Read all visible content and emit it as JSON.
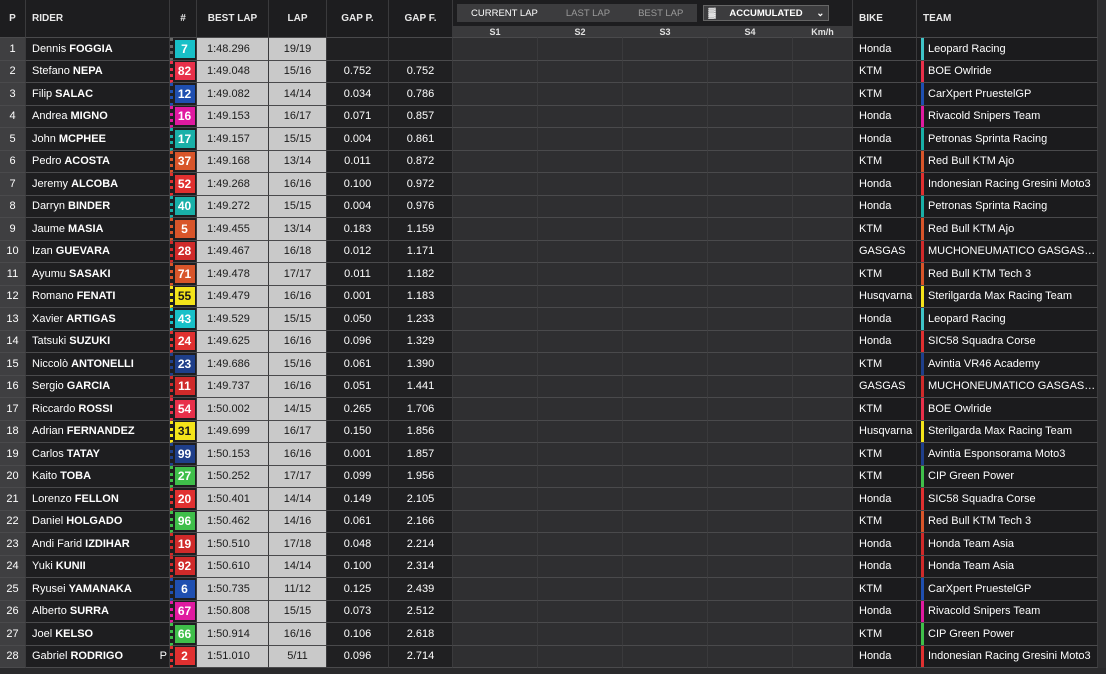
{
  "headers": {
    "pos": "P",
    "rider": "RIDER",
    "num": "#",
    "best_lap": "BEST LAP",
    "lap": "LAP",
    "gap_p": "GAP P.",
    "gap_f": "GAP F.",
    "bike": "BIKE",
    "team": "TEAM",
    "tabs": [
      "CURRENT LAP",
      "LAST LAP",
      "BEST LAP"
    ],
    "mode": "ACCUMULATED",
    "sectors": [
      "S1",
      "S2",
      "S3",
      "S4",
      "Km/h"
    ]
  },
  "rows": [
    {
      "pos": "1",
      "first": "Dennis",
      "last": "FOGGIA",
      "num": "7",
      "num_bg": "#18c0c8",
      "num_fg": "#ffffff",
      "flag": "#6a6a6a",
      "best": "1:48.296",
      "lap": "19/19",
      "gap_p": "",
      "gap_f": "",
      "bike": "Honda",
      "team": "Leopard Racing",
      "team_color": "#3fc4c8",
      "pit": ""
    },
    {
      "pos": "2",
      "first": "Stefano",
      "last": "NEPA",
      "num": "82",
      "num_bg": "#e8304a",
      "num_fg": "#ffffff",
      "flag": "#e8304a",
      "best": "1:49.048",
      "lap": "15/16",
      "gap_p": "0.752",
      "gap_f": "0.752",
      "bike": "KTM",
      "team": "BOE Owlride",
      "team_color": "#e8304a",
      "pit": ""
    },
    {
      "pos": "3",
      "first": "Filip",
      "last": "SALAC",
      "num": "12",
      "num_bg": "#1f4fb0",
      "num_fg": "#ffffff",
      "flag": "#1f4fb0",
      "best": "1:49.082",
      "lap": "14/14",
      "gap_p": "0.034",
      "gap_f": "0.786",
      "bike": "KTM",
      "team": "CarXpert PruestelGP",
      "team_color": "#1f4fb0",
      "pit": ""
    },
    {
      "pos": "4",
      "first": "Andrea",
      "last": "MIGNO",
      "num": "16",
      "num_bg": "#e01aa0",
      "num_fg": "#ffffff",
      "flag": "#e01aa0",
      "best": "1:49.153",
      "lap": "16/17",
      "gap_p": "0.071",
      "gap_f": "0.857",
      "bike": "Honda",
      "team": "Rivacold Snipers Team",
      "team_color": "#e01aa0",
      "pit": ""
    },
    {
      "pos": "5",
      "first": "John",
      "last": "MCPHEE",
      "num": "17",
      "num_bg": "#19b0a8",
      "num_fg": "#ffffff",
      "flag": "#19b0a8",
      "best": "1:49.157",
      "lap": "15/15",
      "gap_p": "0.004",
      "gap_f": "0.861",
      "bike": "Honda",
      "team": "Petronas Sprinta Racing",
      "team_color": "#19b0a8",
      "pit": ""
    },
    {
      "pos": "6",
      "first": "Pedro",
      "last": "ACOSTA",
      "num": "37",
      "num_bg": "#d8552a",
      "num_fg": "#ffffff",
      "flag": "#d8552a",
      "best": "1:49.168",
      "lap": "13/14",
      "gap_p": "0.011",
      "gap_f": "0.872",
      "bike": "KTM",
      "team": "Red Bull KTM Ajo",
      "team_color": "#d8552a",
      "pit": ""
    },
    {
      "pos": "7",
      "first": "Jeremy",
      "last": "ALCOBA",
      "num": "52",
      "num_bg": "#e03030",
      "num_fg": "#ffffff",
      "flag": "#e03030",
      "best": "1:49.268",
      "lap": "16/16",
      "gap_p": "0.100",
      "gap_f": "0.972",
      "bike": "Honda",
      "team": "Indonesian Racing Gresini Moto3",
      "team_color": "#e03030",
      "pit": ""
    },
    {
      "pos": "8",
      "first": "Darryn",
      "last": "BINDER",
      "num": "40",
      "num_bg": "#19b0a8",
      "num_fg": "#ffffff",
      "flag": "#19b0a8",
      "best": "1:49.272",
      "lap": "15/15",
      "gap_p": "0.004",
      "gap_f": "0.976",
      "bike": "Honda",
      "team": "Petronas Sprinta Racing",
      "team_color": "#19b0a8",
      "pit": ""
    },
    {
      "pos": "9",
      "first": "Jaume",
      "last": "MASIA",
      "num": "5",
      "num_bg": "#d8552a",
      "num_fg": "#ffffff",
      "flag": "#d8552a",
      "best": "1:49.455",
      "lap": "13/14",
      "gap_p": "0.183",
      "gap_f": "1.159",
      "bike": "KTM",
      "team": "Red Bull KTM Ajo",
      "team_color": "#d8552a",
      "pit": ""
    },
    {
      "pos": "10",
      "first": "Izan",
      "last": "GUEVARA",
      "num": "28",
      "num_bg": "#d02a2a",
      "num_fg": "#ffffff",
      "flag": "#d02a2a",
      "best": "1:49.467",
      "lap": "16/18",
      "gap_p": "0.012",
      "gap_f": "1.171",
      "bike": "GASGAS",
      "team": "MUCHONEUMATICO GASGAS Asp...",
      "team_color": "#d02a2a",
      "pit": ""
    },
    {
      "pos": "11",
      "first": "Ayumu",
      "last": "SASAKI",
      "num": "71",
      "num_bg": "#d8552a",
      "num_fg": "#ffffff",
      "flag": "#d8552a",
      "best": "1:49.478",
      "lap": "17/17",
      "gap_p": "0.011",
      "gap_f": "1.182",
      "bike": "KTM",
      "team": "Red Bull KTM Tech 3",
      "team_color": "#d8552a",
      "pit": ""
    },
    {
      "pos": "12",
      "first": "Romano",
      "last": "FENATI",
      "num": "55",
      "num_bg": "#f4e41a",
      "num_fg": "#1a1a1a",
      "flag": "#f4e41a",
      "best": "1:49.479",
      "lap": "16/16",
      "gap_p": "0.001",
      "gap_f": "1.183",
      "bike": "Husqvarna",
      "team": "Sterilgarda Max Racing Team",
      "team_color": "#f4e41a",
      "pit": ""
    },
    {
      "pos": "13",
      "first": "Xavier",
      "last": "ARTIGAS",
      "num": "43",
      "num_bg": "#18c0c8",
      "num_fg": "#ffffff",
      "flag": "#18c0c8",
      "best": "1:49.529",
      "lap": "15/15",
      "gap_p": "0.050",
      "gap_f": "1.233",
      "bike": "Honda",
      "team": "Leopard Racing",
      "team_color": "#3fc4c8",
      "pit": ""
    },
    {
      "pos": "14",
      "first": "Tatsuki",
      "last": "SUZUKI",
      "num": "24",
      "num_bg": "#e03030",
      "num_fg": "#ffffff",
      "flag": "#e03030",
      "best": "1:49.625",
      "lap": "16/16",
      "gap_p": "0.096",
      "gap_f": "1.329",
      "bike": "Honda",
      "team": "SIC58 Squadra Corse",
      "team_color": "#e03030",
      "pit": ""
    },
    {
      "pos": "15",
      "first": "Niccolò",
      "last": "ANTONELLI",
      "num": "23",
      "num_bg": "#1f3f8a",
      "num_fg": "#ffffff",
      "flag": "#1f3f8a",
      "best": "1:49.686",
      "lap": "15/16",
      "gap_p": "0.061",
      "gap_f": "1.390",
      "bike": "KTM",
      "team": "Avintia VR46 Academy",
      "team_color": "#1f3f8a",
      "pit": ""
    },
    {
      "pos": "16",
      "first": "Sergio",
      "last": "GARCIA",
      "num": "11",
      "num_bg": "#d02a2a",
      "num_fg": "#ffffff",
      "flag": "#d02a2a",
      "best": "1:49.737",
      "lap": "16/16",
      "gap_p": "0.051",
      "gap_f": "1.441",
      "bike": "GASGAS",
      "team": "MUCHONEUMATICO GASGAS Asp...",
      "team_color": "#d02a2a",
      "pit": ""
    },
    {
      "pos": "17",
      "first": "Riccardo",
      "last": "ROSSI",
      "num": "54",
      "num_bg": "#e8304a",
      "num_fg": "#ffffff",
      "flag": "#e8304a",
      "best": "1:50.002",
      "lap": "14/15",
      "gap_p": "0.265",
      "gap_f": "1.706",
      "bike": "KTM",
      "team": "BOE Owlride",
      "team_color": "#e8304a",
      "pit": ""
    },
    {
      "pos": "18",
      "first": "Adrian",
      "last": "FERNANDEZ",
      "num": "31",
      "num_bg": "#f4e41a",
      "num_fg": "#1a1a1a",
      "flag": "#f4e41a",
      "best": "1:49.699",
      "lap": "16/17",
      "gap_p": "0.150",
      "gap_f": "1.856",
      "bike": "Husqvarna",
      "team": "Sterilgarda Max Racing Team",
      "team_color": "#f4e41a",
      "pit": ""
    },
    {
      "pos": "19",
      "first": "Carlos",
      "last": "TATAY",
      "num": "99",
      "num_bg": "#1f3f8a",
      "num_fg": "#ffffff",
      "flag": "#1f3f8a",
      "best": "1:50.153",
      "lap": "16/16",
      "gap_p": "0.001",
      "gap_f": "1.857",
      "bike": "KTM",
      "team": "Avintia Esponsorama Moto3",
      "team_color": "#1f3f8a",
      "pit": ""
    },
    {
      "pos": "20",
      "first": "Kaito",
      "last": "TOBA",
      "num": "27",
      "num_bg": "#3fbf4a",
      "num_fg": "#ffffff",
      "flag": "#3fbf4a",
      "best": "1:50.252",
      "lap": "17/17",
      "gap_p": "0.099",
      "gap_f": "1.956",
      "bike": "KTM",
      "team": "CIP Green Power",
      "team_color": "#3fbf4a",
      "pit": ""
    },
    {
      "pos": "21",
      "first": "Lorenzo",
      "last": "FELLON",
      "num": "20",
      "num_bg": "#e03030",
      "num_fg": "#ffffff",
      "flag": "#e03030",
      "best": "1:50.401",
      "lap": "14/14",
      "gap_p": "0.149",
      "gap_f": "2.105",
      "bike": "Honda",
      "team": "SIC58 Squadra Corse",
      "team_color": "#e03030",
      "pit": ""
    },
    {
      "pos": "22",
      "first": "Daniel",
      "last": "HOLGADO",
      "num": "96",
      "num_bg": "#3fbf4a",
      "num_fg": "#ffffff",
      "flag": "#3fbf4a",
      "best": "1:50.462",
      "lap": "14/16",
      "gap_p": "0.061",
      "gap_f": "2.166",
      "bike": "KTM",
      "team": "Red Bull KTM Tech 3",
      "team_color": "#d8552a",
      "pit": ""
    },
    {
      "pos": "23",
      "first": "Andi Farid",
      "last": "IZDIHAR",
      "num": "19",
      "num_bg": "#d02a2a",
      "num_fg": "#ffffff",
      "flag": "#d02a2a",
      "best": "1:50.510",
      "lap": "17/18",
      "gap_p": "0.048",
      "gap_f": "2.214",
      "bike": "Honda",
      "team": "Honda Team Asia",
      "team_color": "#d02a2a",
      "pit": ""
    },
    {
      "pos": "24",
      "first": "Yuki",
      "last": "KUNII",
      "num": "92",
      "num_bg": "#d02a2a",
      "num_fg": "#ffffff",
      "flag": "#d02a2a",
      "best": "1:50.610",
      "lap": "14/14",
      "gap_p": "0.100",
      "gap_f": "2.314",
      "bike": "Honda",
      "team": "Honda Team Asia",
      "team_color": "#d02a2a",
      "pit": ""
    },
    {
      "pos": "25",
      "first": "Ryusei",
      "last": "YAMANAKA",
      "num": "6",
      "num_bg": "#1f4fb0",
      "num_fg": "#ffffff",
      "flag": "#1f4fb0",
      "best": "1:50.735",
      "lap": "11/12",
      "gap_p": "0.125",
      "gap_f": "2.439",
      "bike": "KTM",
      "team": "CarXpert PruestelGP",
      "team_color": "#1f4fb0",
      "pit": ""
    },
    {
      "pos": "26",
      "first": "Alberto",
      "last": "SURRA",
      "num": "67",
      "num_bg": "#e01aa0",
      "num_fg": "#ffffff",
      "flag": "#e01aa0",
      "best": "1:50.808",
      "lap": "15/15",
      "gap_p": "0.073",
      "gap_f": "2.512",
      "bike": "Honda",
      "team": "Rivacold Snipers Team",
      "team_color": "#e01aa0",
      "pit": ""
    },
    {
      "pos": "27",
      "first": "Joel",
      "last": "KELSO",
      "num": "66",
      "num_bg": "#3fbf4a",
      "num_fg": "#ffffff",
      "flag": "#3fbf4a",
      "best": "1:50.914",
      "lap": "16/16",
      "gap_p": "0.106",
      "gap_f": "2.618",
      "bike": "KTM",
      "team": "CIP Green Power",
      "team_color": "#3fbf4a",
      "pit": ""
    },
    {
      "pos": "28",
      "first": "Gabriel",
      "last": "RODRIGO",
      "num": "2",
      "num_bg": "#e03030",
      "num_fg": "#ffffff",
      "flag": "#e03030",
      "best": "1:51.010",
      "lap": "5/11",
      "gap_p": "0.096",
      "gap_f": "2.714",
      "bike": "Honda",
      "team": "Indonesian Racing Gresini Moto3",
      "team_color": "#e03030",
      "pit": "P"
    }
  ]
}
